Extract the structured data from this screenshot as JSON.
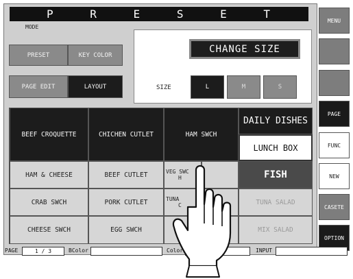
{
  "title": "P R E S E T",
  "mode": {
    "label": "MODE",
    "preset": "PRESET",
    "key_color": "KEY COLOR",
    "page_edit": "PAGE EDIT",
    "layout": "LAYOUT"
  },
  "size_panel": {
    "change_size": "CHANGE SIZE",
    "size_label": "SIZE",
    "large": "L",
    "medium": "M",
    "small": "S"
  },
  "grid": {
    "beef_croquette": "BEEF CROQUETTE",
    "chichen_cutlet": "CHICHEN CUTLET",
    "ham_swch": "HAM SWCH",
    "daily_dishes": "DAILY DISHES",
    "lunch_box": "LUNCH BOX",
    "ham_cheese": "HAM & CHEESE",
    "beef_cutlet": "BEEF CUTLET",
    "veg_swch_partial": "VEG SWC",
    "veg_swch_partial2": "H",
    "fish": "FISH",
    "crab_swch": "CRAB SWCH",
    "pork_cutlet": "PORK CUTLET",
    "tuna_partial": "TUNA",
    "tuna_partial2": "C",
    "tuna_salad": "TUNA SALAD",
    "cheese_swch": "CHEESE SWCH",
    "egg_swch": "EGG SWCH",
    "mix_salad": "MIX SALAD"
  },
  "side": {
    "menu": "MENU",
    "page": "PAGE",
    "func": "FUNC",
    "new": "NEW",
    "casete": "CASETE",
    "option": "OPTION"
  },
  "footer": {
    "page_label": "PAGE",
    "page_value": "1 / 3",
    "bcolor_label": "BColor",
    "color_label": "Color",
    "input_label": "INPUT"
  },
  "colors": {
    "dark_key": "#1c1c1c",
    "gray_key": "#8a8a8a",
    "light_key": "#d6d6d6"
  }
}
